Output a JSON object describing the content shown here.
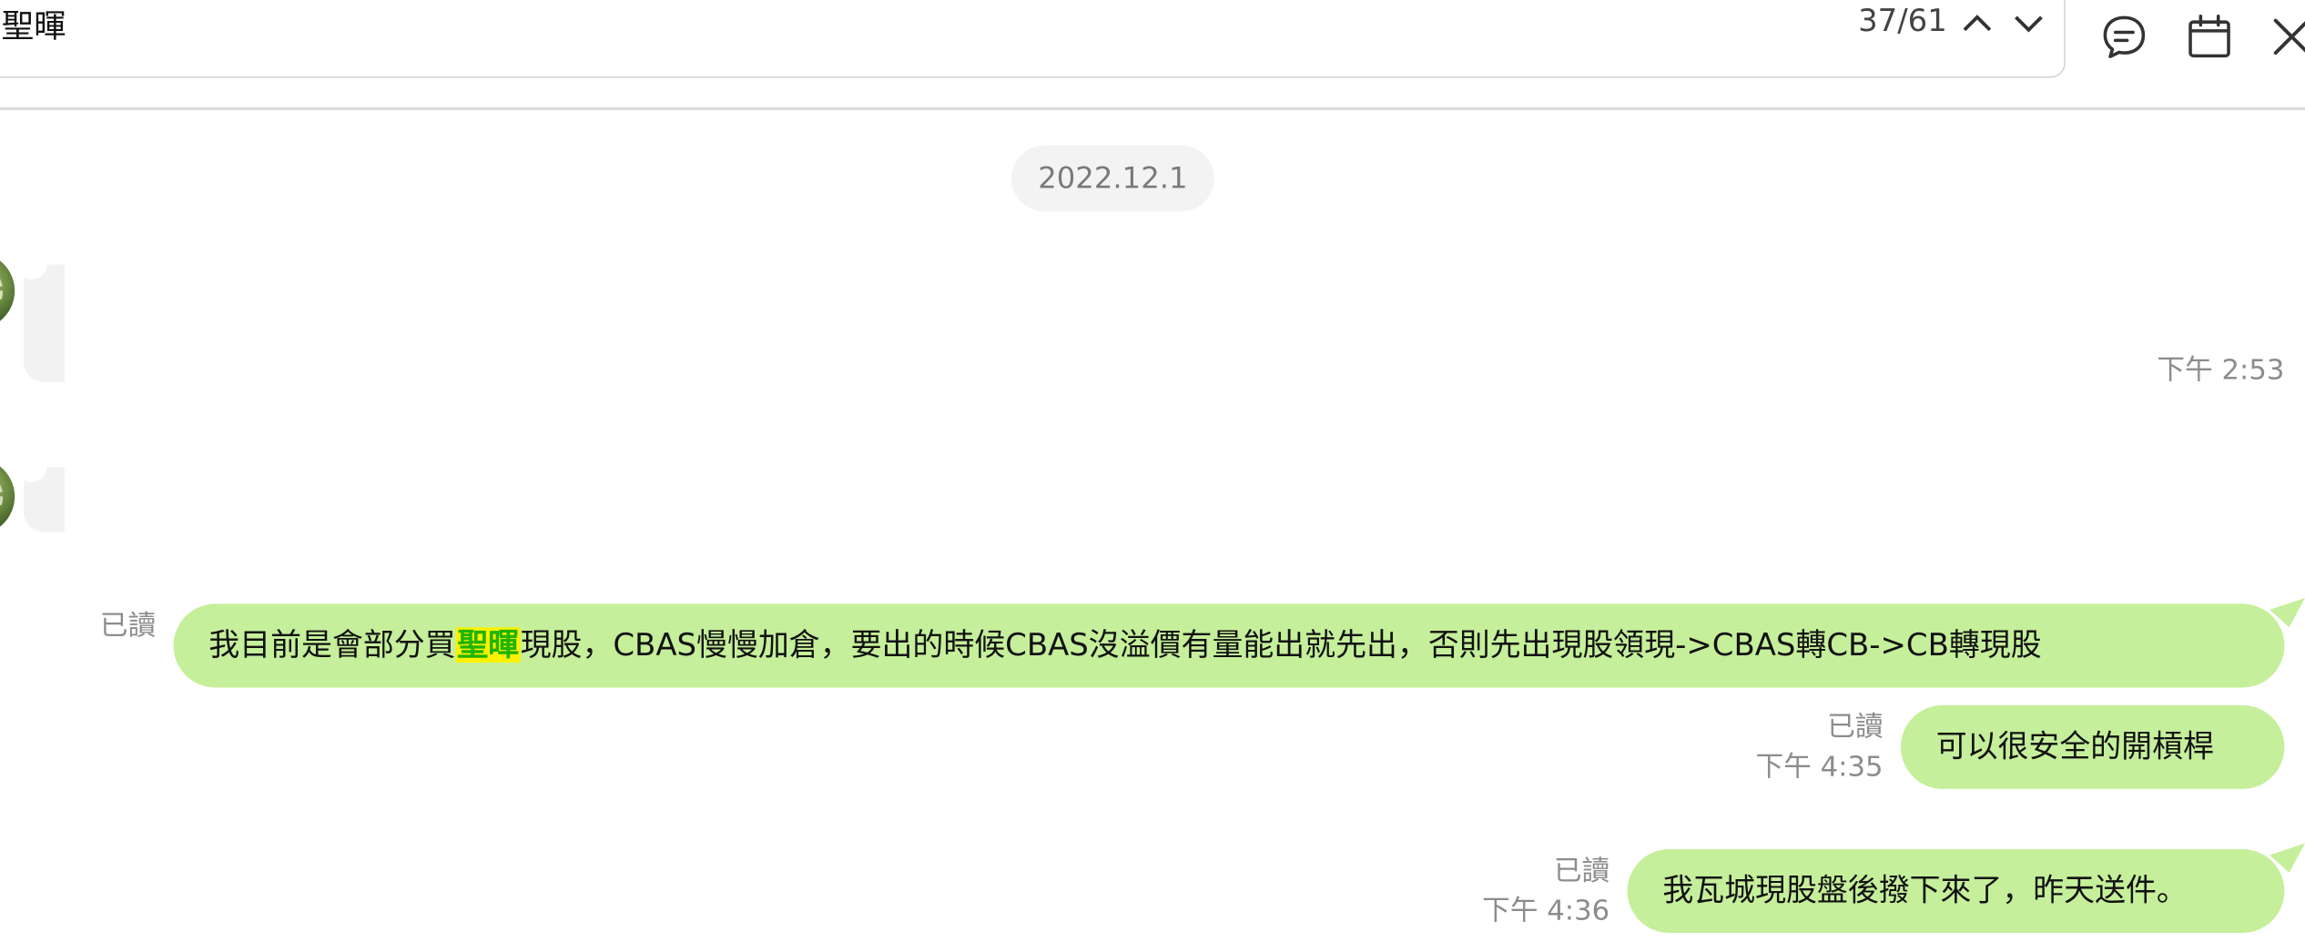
{
  "search": {
    "query": "聖暉",
    "result_position": "37/61",
    "prev_icon": "chevron-up-icon",
    "next_icon": "chevron-down-icon"
  },
  "header_icons": {
    "chat": "chat-bubble-icon",
    "calendar": "calendar-icon",
    "close": "close-icon"
  },
  "date_divider": "2022.12.1",
  "incoming": {
    "time_1": "下午 2:53"
  },
  "messages": [
    {
      "text_before": "我目前是會部分買",
      "text_highlight": "聖暉",
      "text_after": "現股，CBAS慢慢加倉，要出的時候CBAS沒溢價有量能出就先出，否則先出現股領現->CBAS轉CB->CB轉現股",
      "read": "已讀",
      "time": ""
    },
    {
      "text": "可以很安全的開槓桿",
      "read": "已讀",
      "time": "下午 4:35"
    },
    {
      "text": "我瓦城現股盤後撥下來了，昨天送件。",
      "read": "已讀",
      "time": "下午 4:36"
    }
  ],
  "colors": {
    "bubble": "#c5ef9a",
    "highlight_bg": "#fdf100",
    "highlight_text": "#20b400",
    "meta_text": "#8c8c8c"
  }
}
